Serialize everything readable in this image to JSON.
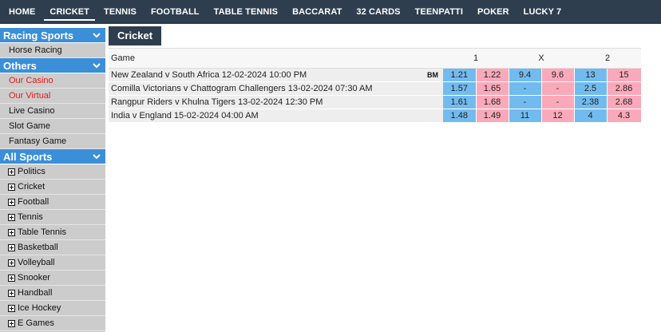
{
  "nav": {
    "items": [
      "HOME",
      "CRICKET",
      "TENNIS",
      "FOOTBALL",
      "TABLE TENNIS",
      "BACCARAT",
      "32 CARDS",
      "TEENPATTI",
      "POKER",
      "LUCKY 7"
    ],
    "active_index": 1
  },
  "sidebar": {
    "racing": {
      "title": "Racing Sports",
      "items": [
        "Horse Racing"
      ]
    },
    "others": {
      "title": "Others",
      "items": [
        "Our Casino",
        "Our Virtual",
        "Live Casino",
        "Slot Game",
        "Fantasy Game"
      ],
      "red_items": [
        "Our Casino",
        "Our Virtual"
      ]
    },
    "all_sports": {
      "title": "All Sports",
      "items": [
        "Politics",
        "Cricket",
        "Football",
        "Tennis",
        "Table Tennis",
        "Basketball",
        "Volleyball",
        "Snooker",
        "Handball",
        "Ice Hockey",
        "E Games"
      ]
    }
  },
  "main": {
    "tab_label": "Cricket",
    "columns": {
      "game": "Game",
      "one": "1",
      "x": "X",
      "two": "2"
    },
    "rows": [
      {
        "game": "New Zealand v South Africa 12-02-2024 10:00 PM",
        "badge": "BM",
        "odds": [
          "1.21",
          "1.22",
          "9.4",
          "9.6",
          "13",
          "15"
        ]
      },
      {
        "game": "Comilla Victorians v Chattogram Challengers 13-02-2024 07:30 AM",
        "badge": "",
        "odds": [
          "1.57",
          "1.65",
          "-",
          "-",
          "2.5",
          "2.86"
        ]
      },
      {
        "game": "Rangpur Riders v Khulna Tigers 13-02-2024 12:30 PM",
        "badge": "",
        "odds": [
          "1.61",
          "1.68",
          "-",
          "-",
          "2.38",
          "2.68"
        ]
      },
      {
        "game": "India v England 15-02-2024 04:00 AM",
        "badge": "",
        "odds": [
          "1.48",
          "1.49",
          "11",
          "12",
          "4",
          "4.3"
        ]
      }
    ]
  },
  "colors": {
    "nav_bg": "#2e3e4e",
    "sidebar_header": "#3a8fd8",
    "back": "#72bbef",
    "lay": "#faa9ba",
    "red_link": "#e01b1b"
  }
}
